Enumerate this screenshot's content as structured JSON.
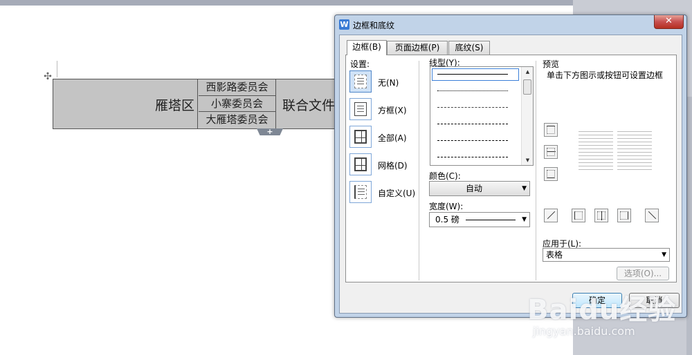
{
  "document": {
    "table": {
      "district": "雁塔区",
      "committees": [
        "西影路委员会",
        "小寨委员会",
        "大雁塔委员会"
      ],
      "doc_title": "联合文件"
    },
    "add_row_symbol": "+",
    "move_handle_symbol": "✣"
  },
  "dialog": {
    "title": "边框和底纹",
    "app_icon_letter": "W",
    "close_symbol": "✕",
    "tabs": [
      {
        "label": "边框(B)",
        "active": true
      },
      {
        "label": "页面边框(P)",
        "active": false
      },
      {
        "label": "底纹(S)",
        "active": false
      }
    ],
    "settings": {
      "label": "设置:",
      "options": [
        {
          "label": "无(N)",
          "selected": true
        },
        {
          "label": "方框(X)",
          "selected": false
        },
        {
          "label": "全部(A)",
          "selected": false
        },
        {
          "label": "网格(D)",
          "selected": false
        },
        {
          "label": "自定义(U)",
          "selected": false
        }
      ]
    },
    "line_style": {
      "label": "线型(Y):",
      "styles": [
        "solid",
        "dotted",
        "dashed-fine",
        "dashed",
        "dash-dot",
        "dash-dot-dot"
      ]
    },
    "color": {
      "label": "颜色(C):",
      "value": "自动"
    },
    "width": {
      "label": "宽度(W):",
      "value": "0.5 磅"
    },
    "preview": {
      "label": "预览",
      "hint": "单击下方图示或按钮可设置边框"
    },
    "apply_to": {
      "label": "应用于(L):",
      "value": "表格"
    },
    "options_button": "选项(O)...",
    "ok_button": "确定",
    "cancel_button": "取消"
  },
  "watermark": {
    "brand": "Baidu经验",
    "url": "jingyan.baidu.com"
  },
  "colors": {
    "desktop_bg": "#a6abb8",
    "dialog_frame": "#c1d3e8",
    "close_red": "#c75050",
    "table_fill": "#c4c4c4",
    "selection_blue": "#3b7fd8"
  }
}
